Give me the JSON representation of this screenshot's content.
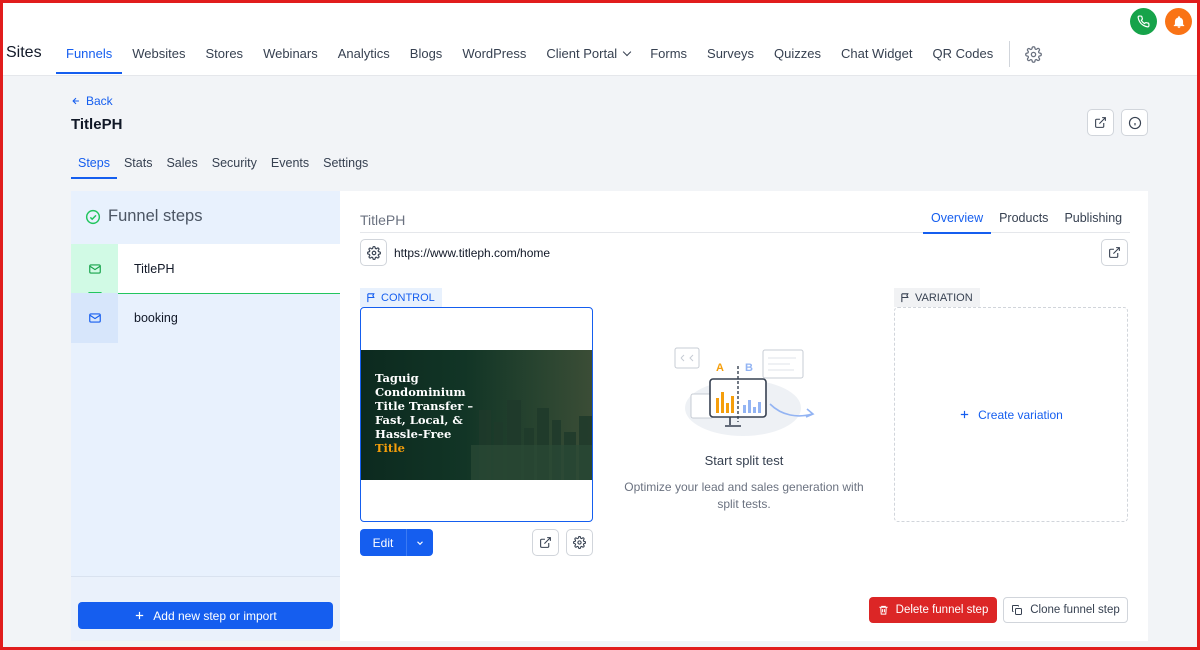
{
  "topnav": {
    "brand": "Sites",
    "items": [
      {
        "label": "Funnels",
        "active": true
      },
      {
        "label": "Websites"
      },
      {
        "label": "Stores"
      },
      {
        "label": "Webinars"
      },
      {
        "label": "Analytics"
      },
      {
        "label": "Blogs"
      },
      {
        "label": "WordPress"
      },
      {
        "label": "Client Portal",
        "dropdown": true
      },
      {
        "label": "Forms"
      },
      {
        "label": "Surveys"
      },
      {
        "label": "Quizzes"
      },
      {
        "label": "Chat Widget"
      },
      {
        "label": "QR Codes"
      }
    ],
    "icons": {
      "settings": "gear-icon",
      "phone": "phone-icon",
      "notifications": "bell-icon"
    }
  },
  "header": {
    "back_label": "Back",
    "title": "TitlePH",
    "tabs": [
      "Steps",
      "Stats",
      "Sales",
      "Security",
      "Events",
      "Settings"
    ],
    "active_tab": "Steps"
  },
  "sidebar": {
    "title": "Funnel steps",
    "steps": [
      {
        "label": "TitlePH",
        "icon": "mail-icon",
        "active": true
      },
      {
        "label": "booking",
        "icon": "mail-icon"
      }
    ],
    "add_button": "Add new step or import"
  },
  "main": {
    "title": "TitlePH",
    "tabs": [
      "Overview",
      "Products",
      "Publishing"
    ],
    "active_tab": "Overview",
    "url": "https://www.titleph.com/home",
    "control": {
      "badge": "CONTROL",
      "preview_text": "Taguig Condominium Title Transfer – Fast, Local, & Hassle-Free",
      "preview_highlight": "Title",
      "edit_label": "Edit"
    },
    "split_test": {
      "label_a": "A",
      "label_b": "B",
      "title": "Start split test",
      "description": "Optimize your lead and sales generation with split tests."
    },
    "variation": {
      "badge": "VARIATION",
      "create_label": "Create variation"
    },
    "delete_label": "Delete funnel step",
    "clone_label": "Clone funnel step"
  },
  "colors": {
    "accent": "#155eef",
    "danger": "#dc2626",
    "success": "#22c55e",
    "frame": "#e11d1d"
  }
}
